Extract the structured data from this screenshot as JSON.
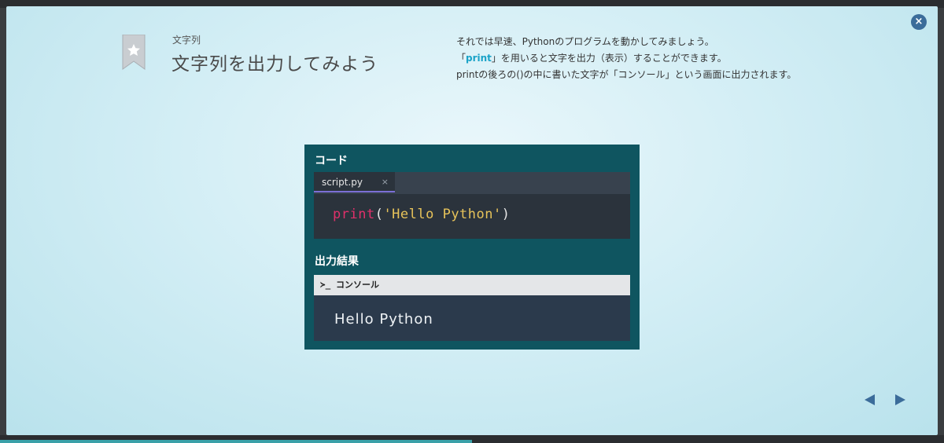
{
  "header": {
    "category": "文字列",
    "title": "文字列を出力してみよう"
  },
  "description": {
    "line1": "それでは早速、Pythonのプログラムを動かしてみましょう。",
    "line2_pre": "「",
    "line2_keyword": "print",
    "line2_post": "」を用いると文字を出力（表示）することができます。",
    "line3": "printの後ろの()の中に書いた文字が「コンソール」という画面に出力されます。"
  },
  "code_panel": {
    "label": "コード",
    "tab_name": "script.py",
    "tab_close": "×",
    "code_func": "print",
    "code_open": "(",
    "code_string": "'Hello Python'",
    "code_close": ")"
  },
  "output_panel": {
    "label": "出力結果",
    "console_prompt": "≻_",
    "console_title": "コンソール",
    "console_output": "Hello Python"
  },
  "controls": {
    "close_label": "×"
  },
  "progress": {
    "fraction": 0.5
  },
  "colors": {
    "accent": "#3b6c9a",
    "panel_bg": "#0f5560",
    "keyword": "#e0306a",
    "string": "#e7c35a",
    "highlight": "#1aa3c8"
  },
  "icons": {
    "bookmark": "bookmark-star-icon",
    "close": "close-icon",
    "prev": "triangle-left-icon",
    "next": "triangle-right-icon",
    "console": "terminal-prompt-icon"
  }
}
